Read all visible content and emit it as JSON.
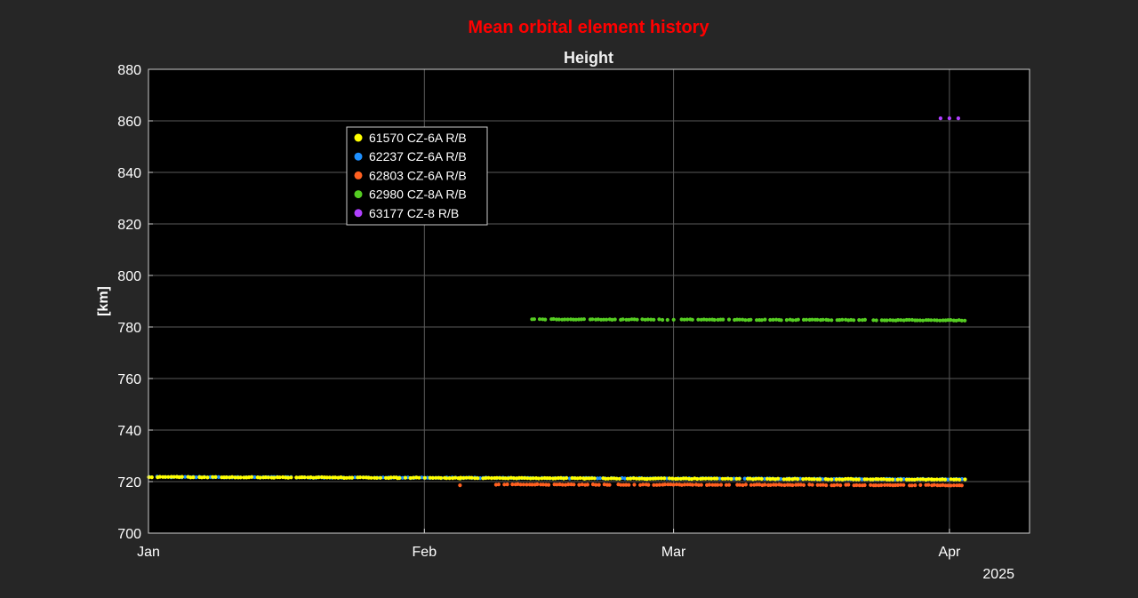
{
  "chart_data": {
    "type": "scatter",
    "title": "Mean orbital element history",
    "title_color": "#ff0000",
    "subtitle": "Height",
    "ylabel": "[km]",
    "xlabel": "",
    "ylim": [
      700,
      880
    ],
    "yticks": [
      700,
      720,
      740,
      760,
      780,
      800,
      820,
      840,
      860,
      880
    ],
    "xlim": [
      "2025-01-01",
      "2025-04-10"
    ],
    "xticks": [
      {
        "date": "2025-01-01",
        "label": "Jan"
      },
      {
        "date": "2025-02-01",
        "label": "Feb"
      },
      {
        "date": "2025-03-01",
        "label": "Mar"
      },
      {
        "date": "2025-04-01",
        "label": "Apr"
      }
    ],
    "year_label": "2025",
    "grid": true,
    "legend_position": "upper-left",
    "background": "#000000",
    "series": [
      {
        "name": "61570 CZ-6A R/B",
        "color": "#ffff00",
        "x_start": "2025-01-01",
        "x_end": "2025-04-03",
        "y_start": 721.8,
        "y_end": 720.8,
        "points": [
          {
            "x": "2025-01-23",
            "y": 721.4
          },
          {
            "x": "2025-01-29",
            "y": 721.3
          },
          {
            "x": "2025-02-05",
            "y": 721.2
          },
          {
            "x": "2025-02-19",
            "y": 721.1
          },
          {
            "x": "2025-02-26",
            "y": 721.0
          },
          {
            "x": "2025-03-14",
            "y": 720.9
          },
          {
            "x": "2025-03-30",
            "y": 720.8
          }
        ]
      },
      {
        "name": "62237 CZ-6A R/B",
        "color": "#1e90ff",
        "x_start": "2025-01-01",
        "x_end": "2025-04-03",
        "y_start": 721.8,
        "y_end": 720.9
      },
      {
        "name": "62803 CZ-6A R/B",
        "color": "#ff6020",
        "x_start": "2025-02-09",
        "x_end": "2025-04-03",
        "y_start": 718.9,
        "y_end": 718.6,
        "points": [
          {
            "x": "2025-02-05",
            "y": 718.6
          }
        ]
      },
      {
        "name": "62980 CZ-8A R/B",
        "color": "#55cc22",
        "x_start": "2025-02-13",
        "x_end": "2025-04-03",
        "y_start": 783.0,
        "y_end": 782.6
      },
      {
        "name": "63177 CZ-8 R/B",
        "color": "#b040ff",
        "points": [
          {
            "x": "2025-03-31",
            "y": 861.0
          },
          {
            "x": "2025-04-01",
            "y": 861.0
          },
          {
            "x": "2025-04-02",
            "y": 861.0
          }
        ]
      }
    ]
  }
}
